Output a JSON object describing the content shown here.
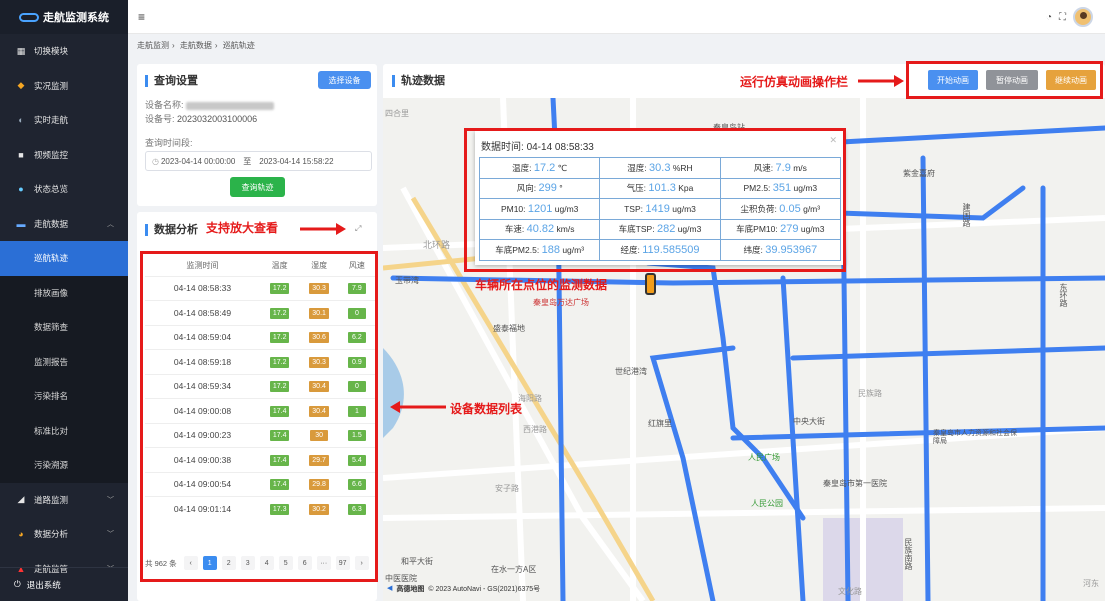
{
  "sidebar": {
    "title": "走航监测系统",
    "items": [
      {
        "label": "切换模块",
        "icon": "grid-icon"
      },
      {
        "label": "实况监测",
        "icon": "diamond-icon"
      },
      {
        "label": "实时走航",
        "icon": "moon-icon"
      },
      {
        "label": "视频监控",
        "icon": "camera-icon"
      },
      {
        "label": "状态总览",
        "icon": "globe-icon"
      },
      {
        "label": "走航数据",
        "icon": "folder-icon",
        "expanded": true
      }
    ],
    "sub_items": [
      "巡航轨迹",
      "排放画像",
      "数据筛查",
      "监测报告",
      "污染排名",
      "标准比对",
      "污染溯源"
    ],
    "active_sub": "巡航轨迹",
    "items_after": [
      {
        "label": "道路监测",
        "icon": "road-icon"
      },
      {
        "label": "数据分析",
        "icon": "pie-icon"
      },
      {
        "label": "走航监管",
        "icon": "warning-icon"
      }
    ],
    "logout": "退出系统"
  },
  "header": {
    "menu_icon": "≡"
  },
  "breadcrumb": [
    "走航监测",
    "走航数据",
    "巡航轨迹"
  ],
  "query": {
    "title": "查询设置",
    "select_button": "选择设备",
    "device_name_label": "设备名称:",
    "device_no_label": "设备号:",
    "device_no": "2023032003100006",
    "time_label": "查询时间段:",
    "start": "2023-04-14 00:00:00",
    "to": "至",
    "end": "2023-04-14 15:58:22",
    "query_button": "查询轨迹"
  },
  "analysis": {
    "title": "数据分析",
    "columns": [
      "监测时间",
      "温度",
      "湿度",
      "风速"
    ],
    "rows": [
      {
        "time": "04-14 08:58:33",
        "temp": "17.2",
        "hum": "30.3",
        "wind": "7.9"
      },
      {
        "time": "04-14 08:58:49",
        "temp": "17.2",
        "hum": "30.1",
        "wind": "0"
      },
      {
        "time": "04-14 08:59:04",
        "temp": "17.2",
        "hum": "30.6",
        "wind": "6.2"
      },
      {
        "time": "04-14 08:59:18",
        "temp": "17.2",
        "hum": "30.3",
        "wind": "0.9"
      },
      {
        "time": "04-14 08:59:34",
        "temp": "17.2",
        "hum": "30.4",
        "wind": "0"
      },
      {
        "time": "04-14 09:00:08",
        "temp": "17.4",
        "hum": "30.4",
        "wind": "1"
      },
      {
        "time": "04-14 09:00:23",
        "temp": "17.4",
        "hum": "30",
        "wind": "1.5"
      },
      {
        "time": "04-14 09:00:38",
        "temp": "17.4",
        "hum": "29.7",
        "wind": "5.4"
      },
      {
        "time": "04-14 09:00:54",
        "temp": "17.4",
        "hum": "29.8",
        "wind": "6.6"
      },
      {
        "time": "04-14 09:01:14",
        "temp": "17.3",
        "hum": "30.2",
        "wind": "6.3"
      }
    ],
    "total": "共 962 条",
    "pages": [
      "1",
      "2",
      "3",
      "4",
      "5",
      "6",
      "···",
      "97"
    ],
    "current_page": "1"
  },
  "track": {
    "title": "轨迹数据",
    "buttons": {
      "start": "开始动画",
      "pause": "暂停动画",
      "resume": "继续动画"
    }
  },
  "popup": {
    "time_label": "数据时间:",
    "time": "04-14 08:58:33",
    "cells": [
      {
        "label": "温度:",
        "value": "17.2",
        "unit": "℃"
      },
      {
        "label": "湿度:",
        "value": "30.3",
        "unit": "%RH"
      },
      {
        "label": "风速:",
        "value": "7.9",
        "unit": "m/s"
      },
      {
        "label": "风向:",
        "value": "299",
        "unit": "°"
      },
      {
        "label": "气压:",
        "value": "101.3",
        "unit": "Kpa"
      },
      {
        "label": "PM2.5:",
        "value": "351",
        "unit": "ug/m3"
      },
      {
        "label": "PM10:",
        "value": "1201",
        "unit": "ug/m3"
      },
      {
        "label": "TSP:",
        "value": "1419",
        "unit": "ug/m3"
      },
      {
        "label": "尘积负荷:",
        "value": "0.05",
        "unit": "g/m³"
      },
      {
        "label": "车速:",
        "value": "40.82",
        "unit": "km/s"
      },
      {
        "label": "车底TSP:",
        "value": "282",
        "unit": "ug/m3"
      },
      {
        "label": "车底PM10:",
        "value": "279",
        "unit": "ug/m3"
      },
      {
        "label": "车底PM2.5:",
        "value": "188",
        "unit": "ug/m³"
      },
      {
        "label": "经度:",
        "value": "119.585509",
        "unit": ""
      },
      {
        "label": "纬度:",
        "value": "39.953967",
        "unit": ""
      }
    ]
  },
  "annotations": {
    "animation_bar": "运行仿真动画操作栏",
    "zoom_hint": "支持放大查看",
    "device_list": "设备数据列表",
    "vehicle_data": "车辆所在点位的监测数据"
  },
  "map": {
    "labels": [
      "四合里",
      "秦皇岛站",
      "紫金嘉府",
      "建国路",
      "北环路",
      "玉带湾",
      "秦皇岛万达广场",
      "盛泰福地",
      "世纪港湾",
      "海阳路",
      "红旗里",
      "西港路",
      "中央大街",
      "人民广场",
      "秦皇岛市人力资源和社会保障局",
      "秦皇岛市第一医院",
      "人民公园",
      "安子路",
      "和平大街",
      "在水一方A区",
      "中医医院",
      "民族南路",
      "东环路",
      "河东",
      "文化路",
      "民族路"
    ],
    "copyright": "© 2023 AutoNavi - GS(2021)6375号",
    "logo": "高德地图"
  },
  "colors": {
    "accent": "#3b8cf0",
    "track": "#3f7ff0",
    "annotation": "#e51a1a",
    "start_btn": "#4a90f0",
    "pause_btn": "#909399",
    "resume_btn": "#e6a23c"
  }
}
